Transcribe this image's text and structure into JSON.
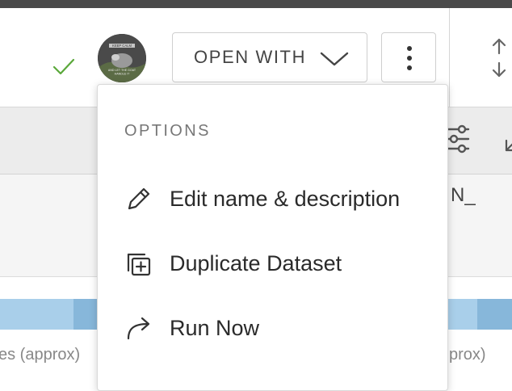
{
  "header": {
    "open_with_label": "OPEN WITH",
    "avatar_caption_line1": "KEEP CALM",
    "avatar_caption_line2": "AND LET THE GOAT",
    "avatar_caption_line3": "HANDLE IT",
    "status": "saved"
  },
  "table": {
    "column_fragment": "N_",
    "left_axis_label": "es (approx)",
    "right_axis_label": "prox)"
  },
  "menu": {
    "heading": "OPTIONS",
    "items": [
      {
        "label": "Edit name & description",
        "icon": "pencil-icon"
      },
      {
        "label": "Duplicate Dataset",
        "icon": "duplicate-icon"
      },
      {
        "label": "Run Now",
        "icon": "redo-arrow-icon"
      }
    ]
  },
  "colors": {
    "accent_check": "#5aa83a",
    "bar_light": "#a9cfea",
    "bar_dark": "#87b7da"
  }
}
